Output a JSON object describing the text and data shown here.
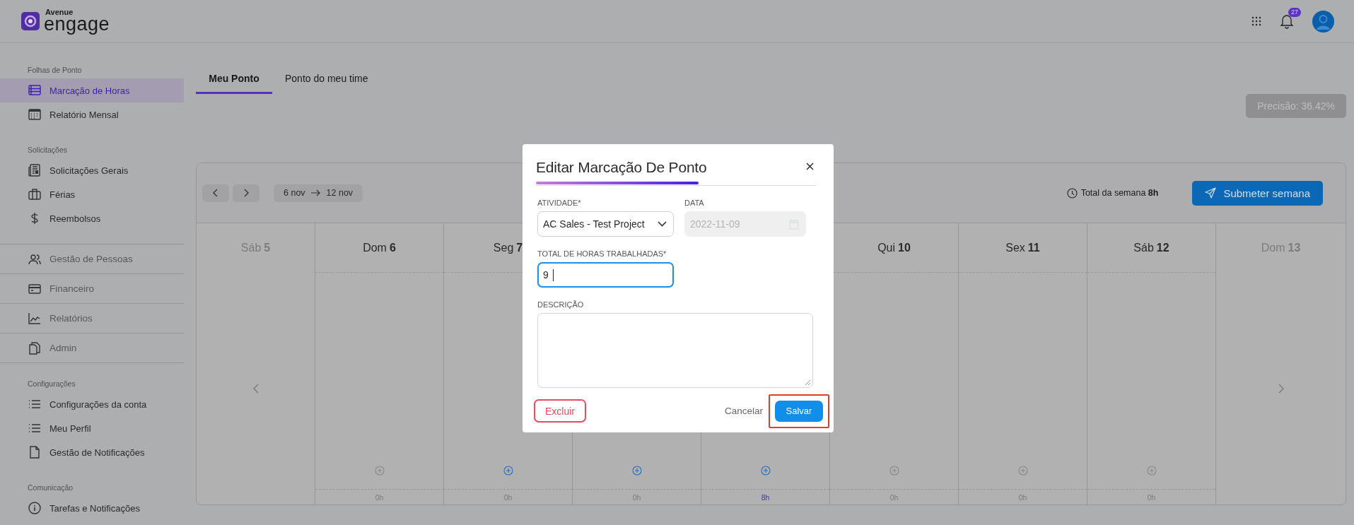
{
  "header": {
    "logo_small": "Avenue",
    "logo_large": "engage",
    "notification_count": "27"
  },
  "sidebar": {
    "sections": [
      {
        "kind": "group",
        "heading": "Folhas de Ponto",
        "items": [
          {
            "label": "Marcação de Horas",
            "selected": true
          },
          {
            "label": "Relatório Mensal",
            "selected": false
          }
        ]
      },
      {
        "kind": "group",
        "heading": "Solicitações",
        "items": [
          {
            "label": "Solicitações Gerais",
            "selected": false
          },
          {
            "label": "Férias",
            "selected": false
          },
          {
            "label": "Reembolsos",
            "selected": false
          }
        ]
      },
      {
        "kind": "link",
        "items": [
          {
            "label": "Gestão de Pessoas",
            "selected": false
          }
        ]
      },
      {
        "kind": "link",
        "items": [
          {
            "label": "Financeiro",
            "selected": false
          }
        ]
      },
      {
        "kind": "link",
        "items": [
          {
            "label": "Relatórios",
            "selected": false
          }
        ]
      },
      {
        "kind": "link",
        "items": [
          {
            "label": "Admin",
            "selected": false
          }
        ]
      },
      {
        "kind": "group",
        "heading": "Configurações",
        "items": [
          {
            "label": "Configurações da conta",
            "selected": false
          },
          {
            "label": "Meu Perfil",
            "selected": false
          },
          {
            "label": "Gestão de Notificações",
            "selected": false
          }
        ]
      },
      {
        "kind": "group",
        "heading": "Comunicação",
        "items": [
          {
            "label": "Tarefas e Notificações",
            "selected": false
          }
        ]
      }
    ]
  },
  "tabs": [
    {
      "label": "Meu Ponto",
      "selected": true
    },
    {
      "label": "Ponto do meu time",
      "selected": false
    }
  ],
  "precision": "Precisão: 36.42%",
  "calendar": {
    "range_start": "6 nov",
    "range_end": "12 nov",
    "total": "Total da semana **8h**",
    "submit_label": "Submeter semana",
    "days": [
      {
        "kind": "outside",
        "weekday": "Sáb",
        "day": "5"
      },
      {
        "kind": "week",
        "weekday": "Dom",
        "day": "6",
        "hours": "0h",
        "highlighted": false,
        "add_enabled": false
      },
      {
        "kind": "week",
        "weekday": "Seg",
        "day": "7",
        "hours": "0h",
        "highlighted": false,
        "add_enabled": true
      },
      {
        "kind": "week",
        "hours": "0h",
        "highlighted": false,
        "add_enabled": true
      },
      {
        "kind": "week",
        "hours": "8h",
        "highlighted": true,
        "add_enabled": true
      },
      {
        "kind": "week",
        "weekday": "Qui",
        "day": "10",
        "hours": "0h",
        "highlighted": false,
        "add_enabled": false
      },
      {
        "kind": "week",
        "weekday": "Sex",
        "day": "11",
        "hours": "0h",
        "highlighted": false,
        "add_enabled": false
      },
      {
        "kind": "week",
        "weekday": "Sáb",
        "day": "12",
        "hours": "0h",
        "highlighted": false,
        "add_enabled": false
      },
      {
        "kind": "outside",
        "weekday": "Dom",
        "day": "13"
      }
    ]
  },
  "modal": {
    "title": "Editar Marcação De Ponto",
    "fields": [
      {
        "kind": "select",
        "label": "ATIVIDADE*",
        "value": "AC Sales - Test Project"
      },
      {
        "kind": "date",
        "label": "DATA",
        "value": "2022-11-09",
        "disabled": true
      },
      {
        "kind": "text",
        "label": "TOTAL DE HORAS TRABALHADAS*",
        "value": "9",
        "focused": true
      },
      {
        "kind": "textarea",
        "label": "DESCRIÇÃO"
      }
    ],
    "delete_label": "Excluir",
    "cancel_label": "Cancelar",
    "save_label": "Salvar",
    "save_highlighted": true
  }
}
